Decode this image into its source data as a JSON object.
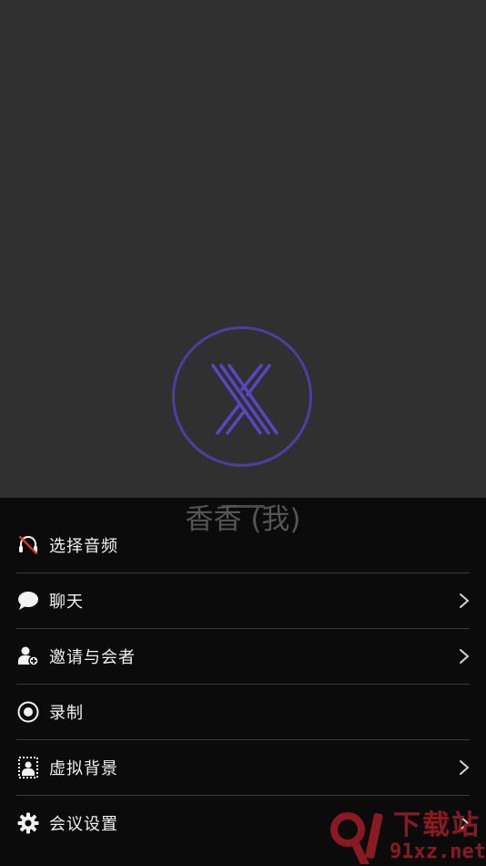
{
  "participant": {
    "name": "香香 (我)"
  },
  "menu": {
    "items": [
      {
        "label": "选择音频",
        "icon": "headset-muted-icon",
        "has_arrow": false
      },
      {
        "label": "聊天",
        "icon": "chat-bubble-icon",
        "has_arrow": true
      },
      {
        "label": "邀请与会者",
        "icon": "add-user-icon",
        "has_arrow": true
      },
      {
        "label": "录制",
        "icon": "record-icon",
        "has_arrow": false
      },
      {
        "label": "虚拟背景",
        "icon": "virtual-background-icon",
        "has_arrow": true
      },
      {
        "label": "会议设置",
        "icon": "gear-icon",
        "has_arrow": true
      }
    ]
  },
  "watermark": {
    "top": "下载站",
    "bottom": "91xz.net"
  },
  "colors": {
    "video_bg": "#303030",
    "sheet_bg": "#0b0b0b",
    "avatar_accent": "#4b3fa2",
    "divider": "#3a3a3a",
    "text": "#f2f2f2",
    "mute_red": "#e0342c"
  }
}
